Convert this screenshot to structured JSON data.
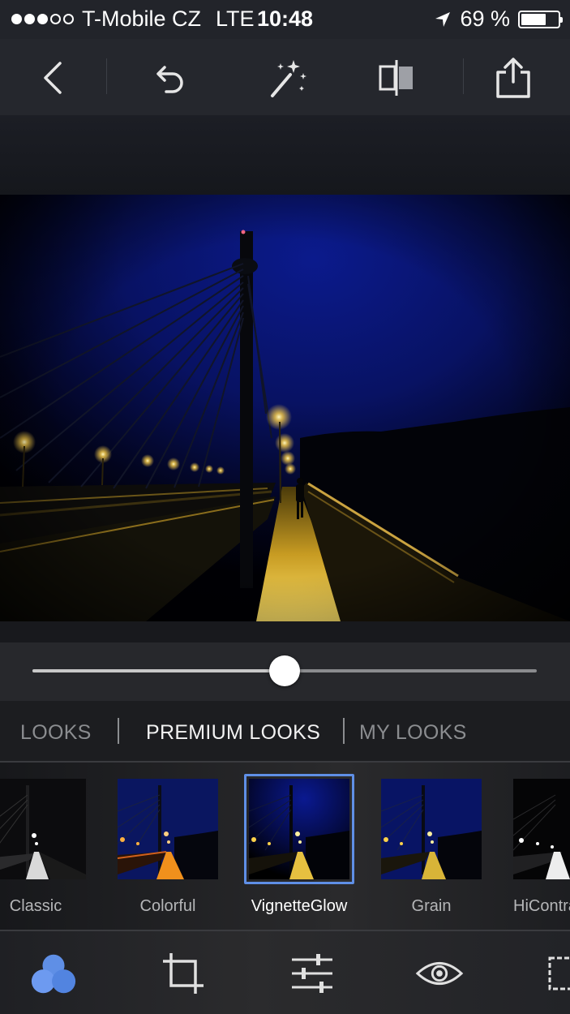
{
  "status_bar": {
    "carrier": "T-Mobile CZ",
    "network": "LTE",
    "time": "10:48",
    "battery": "69 %",
    "battery_level": 0.69,
    "signal_bars_filled": 3,
    "signal_bars_total": 5
  },
  "toolbar": {
    "back": "chevron-left-icon",
    "undo": "undo-icon",
    "auto": "magic-wand-icon",
    "compare": "split-compare-icon",
    "share": "share-icon"
  },
  "slider": {
    "value": 0.5
  },
  "tabs": [
    {
      "label": "LOOKS",
      "active": false
    },
    {
      "label": "PREMIUM LOOKS",
      "active": true
    },
    {
      "label": "MY LOOKS",
      "active": false
    }
  ],
  "looks": [
    {
      "label": "Classic",
      "selected": false
    },
    {
      "label": "Colorful",
      "selected": false
    },
    {
      "label": "VignetteGlow",
      "selected": true
    },
    {
      "label": "Grain",
      "selected": false
    },
    {
      "label": "HiContrast",
      "selected": false
    }
  ],
  "bottom_nav": [
    {
      "icon": "looks-circles-icon",
      "active": true
    },
    {
      "icon": "crop-icon",
      "active": false
    },
    {
      "icon": "adjust-sliders-icon",
      "active": false
    },
    {
      "icon": "eye-icon",
      "active": false
    },
    {
      "icon": "selective-icon",
      "active": false
    }
  ],
  "colors": {
    "accent": "#5f8fe6",
    "sky": "#0a1780",
    "light": "#ffd24a"
  }
}
